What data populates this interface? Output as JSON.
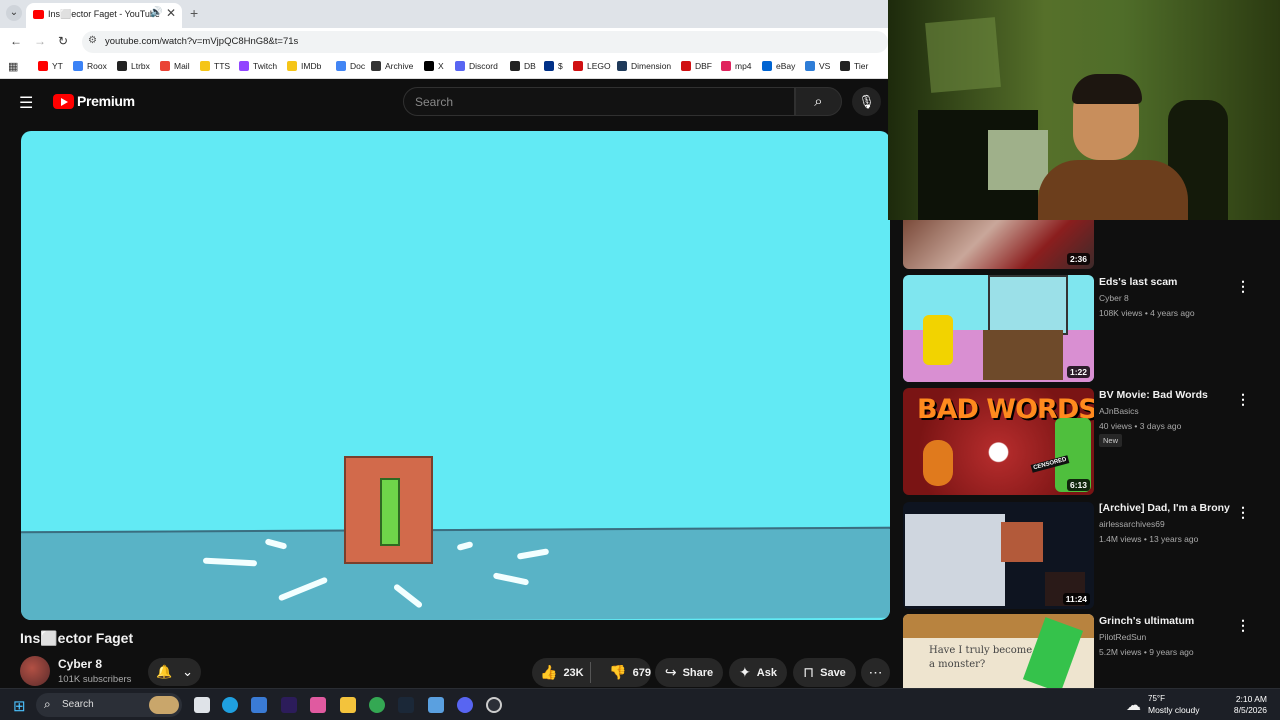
{
  "browser": {
    "tab_title": "Ins⬜ector Faget - YouTube",
    "url": "youtube.com/watch?v=mVjpQC8HnG8&t=71s",
    "bookmarks": [
      {
        "label": "YT",
        "color": "#ff0000"
      },
      {
        "label": "Roox",
        "color": "#3b82f6"
      },
      {
        "label": "Ltrbx",
        "color": "#222222"
      },
      {
        "label": "Mail",
        "color": "#ea4335"
      },
      {
        "label": "TTS",
        "color": "#f5c518"
      },
      {
        "label": "Twitch",
        "color": "#9146ff"
      },
      {
        "label": "IMDb",
        "color": "#f5c518"
      },
      {
        "label": "Doc",
        "color": "#4285f4"
      },
      {
        "label": "Archive",
        "color": "#333333"
      },
      {
        "label": "X",
        "color": "#000000"
      },
      {
        "label": "Discord",
        "color": "#5865f2"
      },
      {
        "label": "DB",
        "color": "#222222"
      },
      {
        "label": "$",
        "color": "#003087"
      },
      {
        "label": "LEGO",
        "color": "#d01012"
      },
      {
        "label": "Dimension",
        "color": "#1f3a5a"
      },
      {
        "label": "DBF",
        "color": "#d01012"
      },
      {
        "label": "mp4",
        "color": "#e0245e"
      },
      {
        "label": "eBay",
        "color": "#0064d2"
      },
      {
        "label": "VS",
        "color": "#2e7dd7"
      },
      {
        "label": "Tier",
        "color": "#222222"
      }
    ]
  },
  "youtube": {
    "brand": "Premium",
    "search_placeholder": "Search"
  },
  "video": {
    "title": "Ins⬜ector Faget",
    "channel": "Cyber 8",
    "subscribers": "101K subscribers",
    "likes": "23K",
    "dislikes": "679",
    "share_label": "Share",
    "ask_label": "Ask",
    "save_label": "Save"
  },
  "recommendations": [
    {
      "title": "",
      "channel": "",
      "meta": "",
      "duration": "2:36",
      "new": ""
    },
    {
      "title": "Eds's last scam",
      "channel": "Cyber 8",
      "meta": "108K views • 4 years ago",
      "duration": "1:22",
      "new": ""
    },
    {
      "title": "BV Movie: Bad Words",
      "channel": "AJnBasics",
      "meta": "40 views • 3 days ago",
      "duration": "6:13",
      "new": "New"
    },
    {
      "title": "[Archive] Dad, I'm a Brony",
      "channel": "airlessarchives69",
      "meta": "1.4M views • 13 years ago",
      "duration": "11:24",
      "new": ""
    },
    {
      "title": "Grinch's ultimatum",
      "channel": "PilotRedSun",
      "meta": "5.2M views • 9 years ago",
      "duration": "",
      "new": ""
    }
  ],
  "thumb_text": {
    "bad_words": "BAD WORDS",
    "censored": "CENSORED",
    "grinch_handwriting": "Have I truly become a monster?"
  },
  "taskbar": {
    "search_label": "Search",
    "weather_temp": "75°F",
    "weather_desc": "Mostly cloudy",
    "time": "2:10 AM",
    "date": "8/5/2026"
  }
}
